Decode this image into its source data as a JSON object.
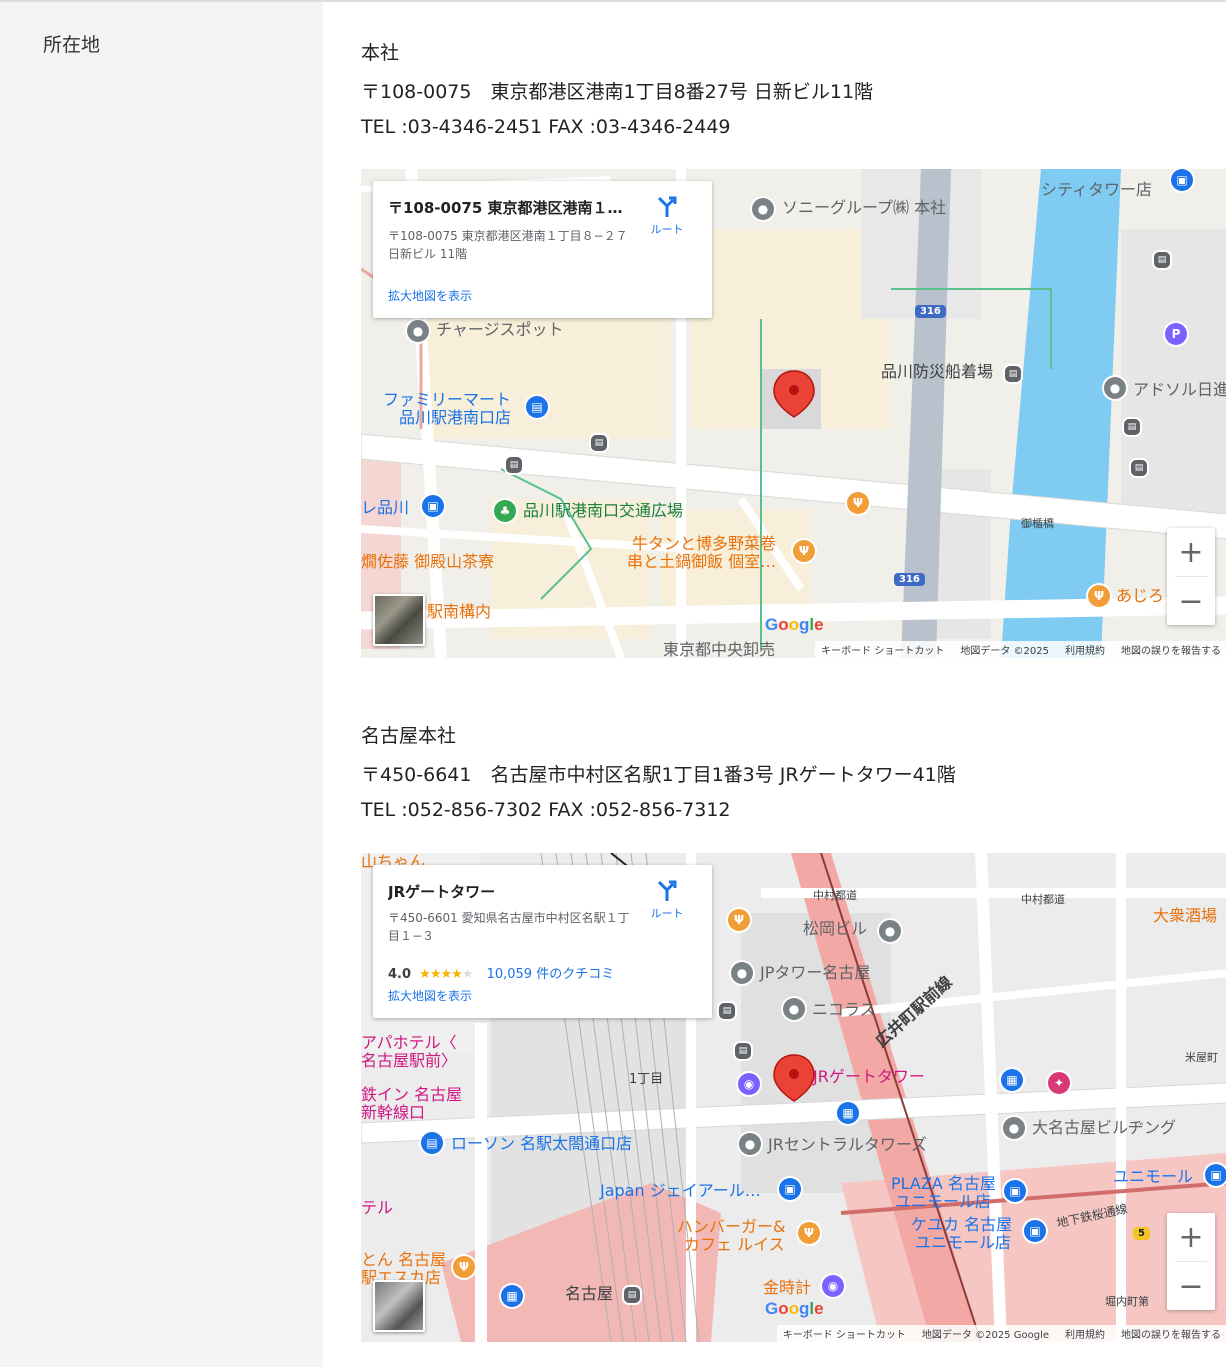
{
  "section_label": "所在地",
  "offices": [
    {
      "name": "本社",
      "address": "〒108-0075　東京都港区港南1丁目8番27号 日新ビル11階",
      "tel": "TEL :03-4346-2451 FAX :03-4346-2449",
      "map": {
        "info_title": "〒108-0075 東京都港区港南１丁...",
        "info_address": "〒108-0075 東京都港区港南１丁目８−２７ 日新ビル 11階",
        "route_label": "ルート",
        "larger_map_link": "拡大地図を表示",
        "labels": {
          "sony": "ソニーグループ㈱ 本社",
          "city_tower": "シティタワー店",
          "charge": "チャージスポット",
          "family_mart_1": "ファミリーマート",
          "family_mart_2": "品川駅港南口店",
          "bousai": "品川防災船着場",
          "adsol": "アドソル日進",
          "plaza": "品川駅港南口交通広場",
          "gyutan_1": "牛タンと博多野菜巻",
          "gyutan_2": "串と土鍋御飯 個室…",
          "re_shinagawa": "レ品川",
          "sato": "燗佐藤 御殿山茶寮",
          "station_south": "駅南構内",
          "ajiro": "あじろ",
          "oyasumi_bridge": "御楯橋",
          "market": "東京都中央卸売",
          "route_316a": "316",
          "route_316b": "316"
        },
        "attribution": {
          "shortcuts": "キーボード ショートカット",
          "mapdata": "地図データ ©2025",
          "terms": "利用規約",
          "report": "地図の誤りを報告する"
        }
      }
    },
    {
      "name": "名古屋本社",
      "address": "〒450-6641　名古屋市中村区名駅1丁目1番3号 JRゲートタワー41階",
      "tel": "TEL :052-856-7302 FAX :052-856-7312",
      "map": {
        "info_title": "JRゲートタワー",
        "info_address": "〒450-6601 愛知県名古屋市中村区名駅１丁目１−３",
        "rating_value": "4.0",
        "rating_stars": 4,
        "reviews": "10,059 件のクチコミ",
        "route_label": "ルート",
        "larger_map_link": "拡大地図を表示",
        "labels": {
          "matsuoka": "松岡ビル",
          "jp_tower": "JPタワー名古屋",
          "nikorasu": "ニコラス",
          "hiroi_line": "広井町駅前線",
          "nakamura_1": "中村都道",
          "nakamura_2": "中村都道",
          "taishu_sakaba": "大衆酒場",
          "apa_1": "アパホテル〈",
          "apa_2": "名古屋駅前〉",
          "inn_1": "鉄イン 名古屋",
          "inn_2": "新幹線口",
          "chome": "1丁目",
          "jr_gate": "JRゲートタワー",
          "dai_nagoya": "大名古屋ビルヂング",
          "yoneya": "米屋町",
          "lawson": "ローソン 名駅太閤通口店",
          "central_towers": "JRセントラルタワーズ",
          "unimall": "ユニモール",
          "japan_jr": "Japan ジェイアール…",
          "plaza_1": "PLAZA 名古屋",
          "plaza_2": "ユニモール店",
          "hotel": "テル",
          "burger_1": "ハンバーガー&",
          "burger_2": "カフェ ルイス",
          "keyuka_1": "ケユカ 名古屋",
          "keyuka_2": "ユニモール店",
          "subway": "地下鉄桜通線",
          "ton_1": "とん 名古屋",
          "ton_2": "駅エスカ店",
          "nagoya": "名古屋",
          "kindokei": "金時計",
          "horiuchi": "堀内町第",
          "yamachan": "山ちゃん",
          "route_5": "5"
        },
        "attribution": {
          "shortcuts": "キーボード ショートカット",
          "mapdata": "地図データ ©2025 Google",
          "terms": "利用規約",
          "report": "地図の誤りを報告する"
        }
      }
    }
  ],
  "icons": {
    "pin": "map-pin-icon",
    "zoom_in": "+",
    "zoom_out": "−",
    "route": "directions-icon"
  },
  "colors": {
    "water": "#7fcbf2",
    "road": "#ffffff",
    "highway": "#b8c1cc",
    "pin": "#ea4335",
    "rail_area": "#f2b8b5",
    "link": "#1a73e8"
  }
}
